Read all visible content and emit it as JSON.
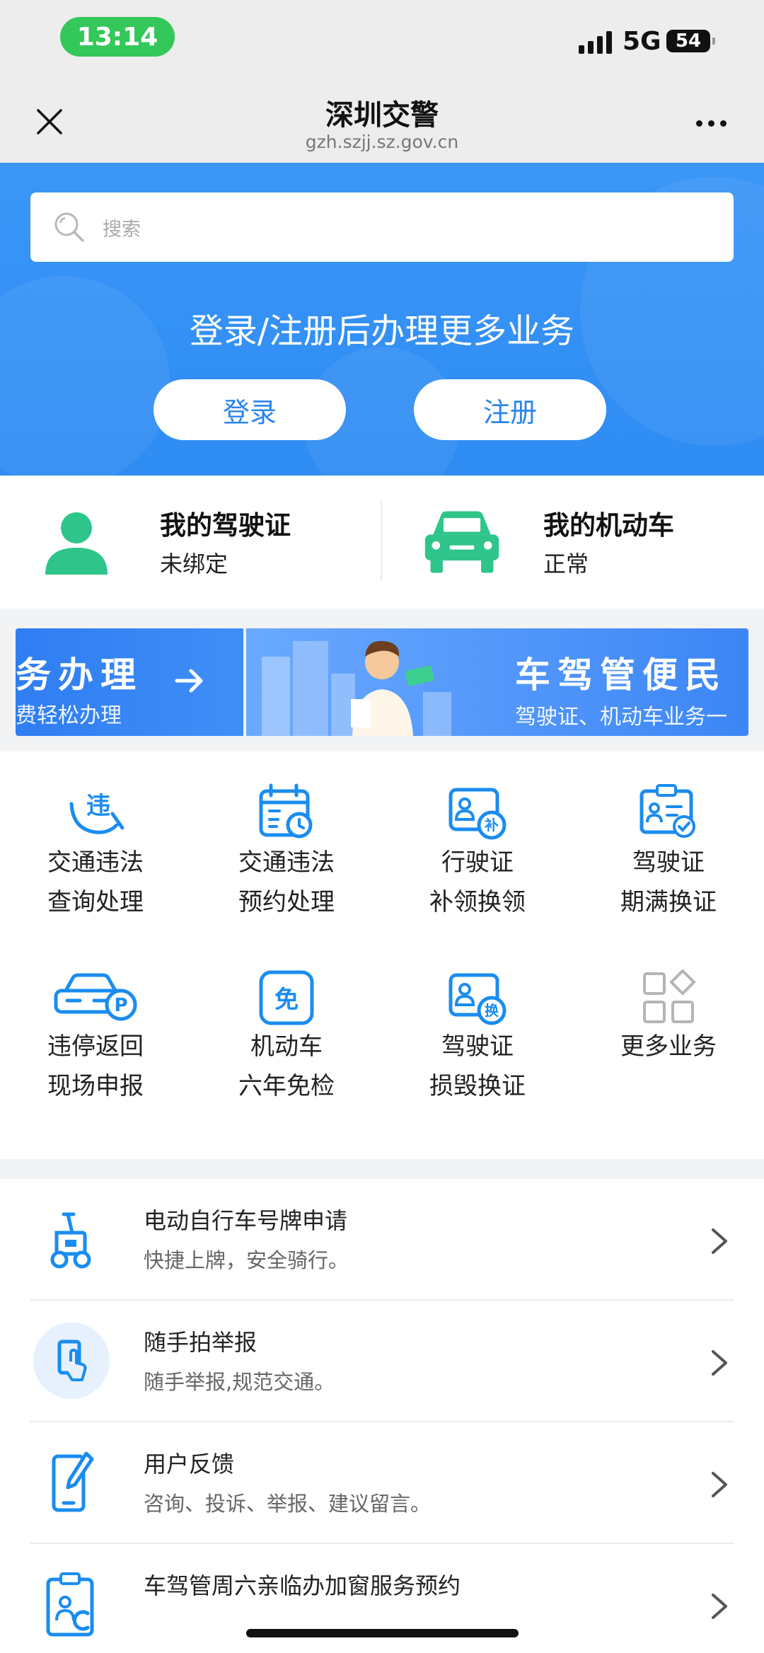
{
  "status_bar": {
    "time": "13:14",
    "network": "5G",
    "battery": "54"
  },
  "nav": {
    "title": "深圳交警",
    "url": "gzh.szjj.sz.gov.cn"
  },
  "hero": {
    "search_placeholder": "搜索",
    "prompt": "登录/注册后办理更多业务",
    "login_label": "登录",
    "register_label": "注册"
  },
  "cards": {
    "license": {
      "title": "我的驾驶证",
      "status": "未绑定"
    },
    "vehicle": {
      "title": "我的机动车",
      "status": "正常"
    }
  },
  "banner": {
    "left_title": "务办理",
    "left_sub": "费轻松办理",
    "right_title": "车驾管便民",
    "right_sub": "驾驶证、机动车业务一"
  },
  "services": [
    {
      "line1": "交通违法",
      "line2": "查询处理",
      "icon": "violation-icon"
    },
    {
      "line1": "交通违法",
      "line2": "预约处理",
      "icon": "calendar-clock-icon"
    },
    {
      "line1": "行驶证",
      "line2": "补领换领",
      "icon": "id-card-reissue-icon"
    },
    {
      "line1": "驾驶证",
      "line2": "期满换证",
      "icon": "license-check-icon"
    },
    {
      "line1": "违停返回",
      "line2": "现场申报",
      "icon": "car-parking-icon"
    },
    {
      "line1": "机动车",
      "line2": "六年免检",
      "icon": "exempt-icon"
    },
    {
      "line1": "驾驶证",
      "line2": "损毁换证",
      "icon": "id-card-exchange-icon"
    },
    {
      "line1": "更多业务",
      "line2": "",
      "icon": "more-grid-icon"
    }
  ],
  "list": [
    {
      "title": "电动自行车号牌申请",
      "subtitle": "快捷上牌，安全骑行。",
      "icon": "scooter-icon"
    },
    {
      "title": "随手拍举报",
      "subtitle": "随手举报,规范交通。",
      "icon": "phone-tap-icon"
    },
    {
      "title": "用户反馈",
      "subtitle": "咨询、投诉、举报、建议留言。",
      "icon": "phone-edit-icon"
    },
    {
      "title": "车驾管周六亲临办加窗服务预约",
      "subtitle": "",
      "icon": "clipboard-user-icon"
    }
  ],
  "colors": {
    "primary": "#2e8cf3",
    "green": "#2fc58a",
    "icon_blue": "#1a8cf0"
  }
}
